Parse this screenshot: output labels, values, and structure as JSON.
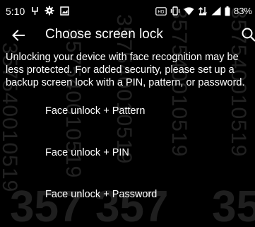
{
  "status_bar": {
    "time": "5:10",
    "battery": "83%",
    "icons": [
      "notification-icon",
      "gear-icon",
      "image-icon",
      "hd-voice-icon",
      "vibrate-icon",
      "wifi-icon",
      "data-transfer-icon",
      "signal-icon",
      "battery-icon"
    ]
  },
  "toolbar": {
    "back_icon": "arrow-left-icon",
    "title": "Choose screen lock",
    "search_icon": "search-icon"
  },
  "description": "Unlocking your device with face recognition may be less protected. For added security, please set up a backup screen lock with a PIN, pattern, or password.",
  "options": [
    {
      "label": "Face unlock + Pattern"
    },
    {
      "label": "Face unlock + PIN"
    },
    {
      "label": "Face unlock + Password"
    }
  ],
  "watermark": {
    "vertical_text": "357540010519",
    "big_text": "357"
  },
  "colors": {
    "background": "#000000",
    "text": "#ffffff"
  }
}
